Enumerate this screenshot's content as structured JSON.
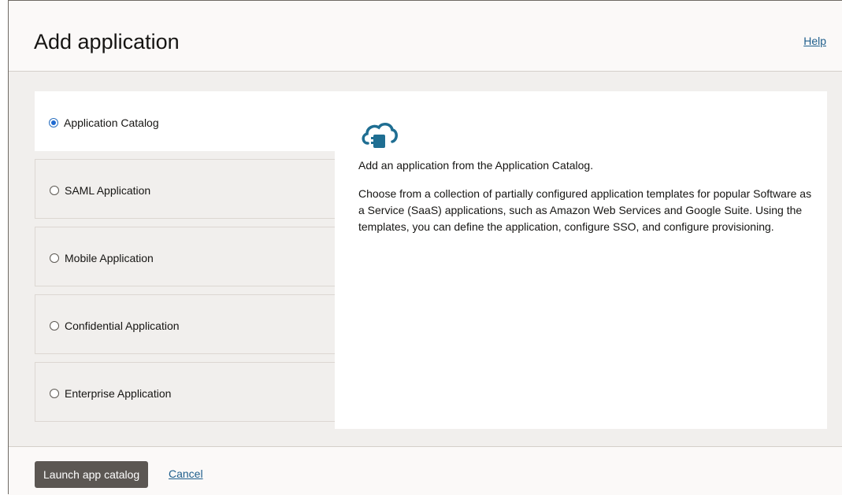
{
  "header": {
    "title": "Add application",
    "help_label": "Help"
  },
  "options": [
    {
      "label": "Application Catalog",
      "selected": true
    },
    {
      "label": "SAML Application",
      "selected": false
    },
    {
      "label": "Mobile Application",
      "selected": false
    },
    {
      "label": "Confidential Application",
      "selected": false
    },
    {
      "label": "Enterprise Application",
      "selected": false
    }
  ],
  "detail": {
    "icon": "cloud-app-icon",
    "heading": "Add an application from the Application Catalog.",
    "description": "Choose from a collection of partially configured application templates for popular Software as a Service (SaaS) applications, such as Amazon Web Services and Google Suite. Using the templates, you can define the application, configure SSO, and configure provisioning."
  },
  "footer": {
    "primary_label": "Launch app catalog",
    "cancel_label": "Cancel"
  },
  "colors": {
    "primary_button": "#5c5753",
    "link": "#1e5e8c",
    "icon": "#1f6e92",
    "radio_selected": "#1f6ad1"
  }
}
